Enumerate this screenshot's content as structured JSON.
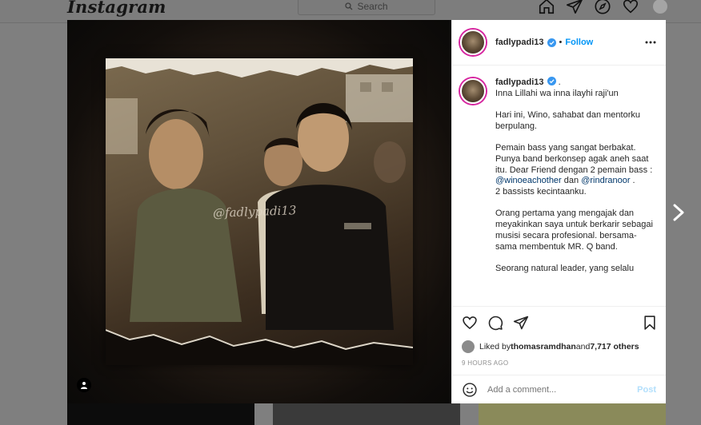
{
  "app": {
    "logo": "Instagram"
  },
  "search": {
    "placeholder": "Search"
  },
  "post": {
    "username": "fadlypadi13",
    "follow_label": "Follow",
    "dot": "•",
    "watermark": "@fadlypadi13",
    "caption": {
      "username": "fadlypadi13",
      "suffix": " .",
      "lines": [
        "Inna Lillahi wa inna ilayhi raji'un",
        "",
        "Hari ini, Wino, sahabat dan mentorku berpulang.",
        "",
        "Pemain bass yang sangat berbakat. Punya band berkonsep agak aneh saat itu. Dear Friend dengan 2 pemain bass : "
      ],
      "mention1": "@winoeachother",
      "between": " dan ",
      "mention2": "@rindranoor",
      "after_mentions": " .\n2 bassists kecintaanku.\n\nOrang pertama yang mengajak dan meyakinkan saya untuk berkarir sebagai musisi secara profesional. bersama-sama membentuk MR. Q band.\n\nSeorang natural leader, yang selalu"
    },
    "likes": {
      "prefix": "Liked by ",
      "user": "thomasramdhan",
      "and": " and ",
      "others": "7,717 others"
    },
    "timestamp": "9 HOURS AGO",
    "comment_placeholder": "Add a comment...",
    "post_label": "Post"
  },
  "icons": {
    "nav": [
      "home-icon",
      "direct-icon",
      "explore-icon",
      "activity-icon"
    ],
    "actions": [
      "like-icon",
      "comment-icon",
      "share-icon",
      "save-icon"
    ]
  },
  "colors": {
    "follow": "#0095f6",
    "mention": "#00376b",
    "post_disabled": "#b2dffc",
    "story_ring": "#d6249f"
  }
}
